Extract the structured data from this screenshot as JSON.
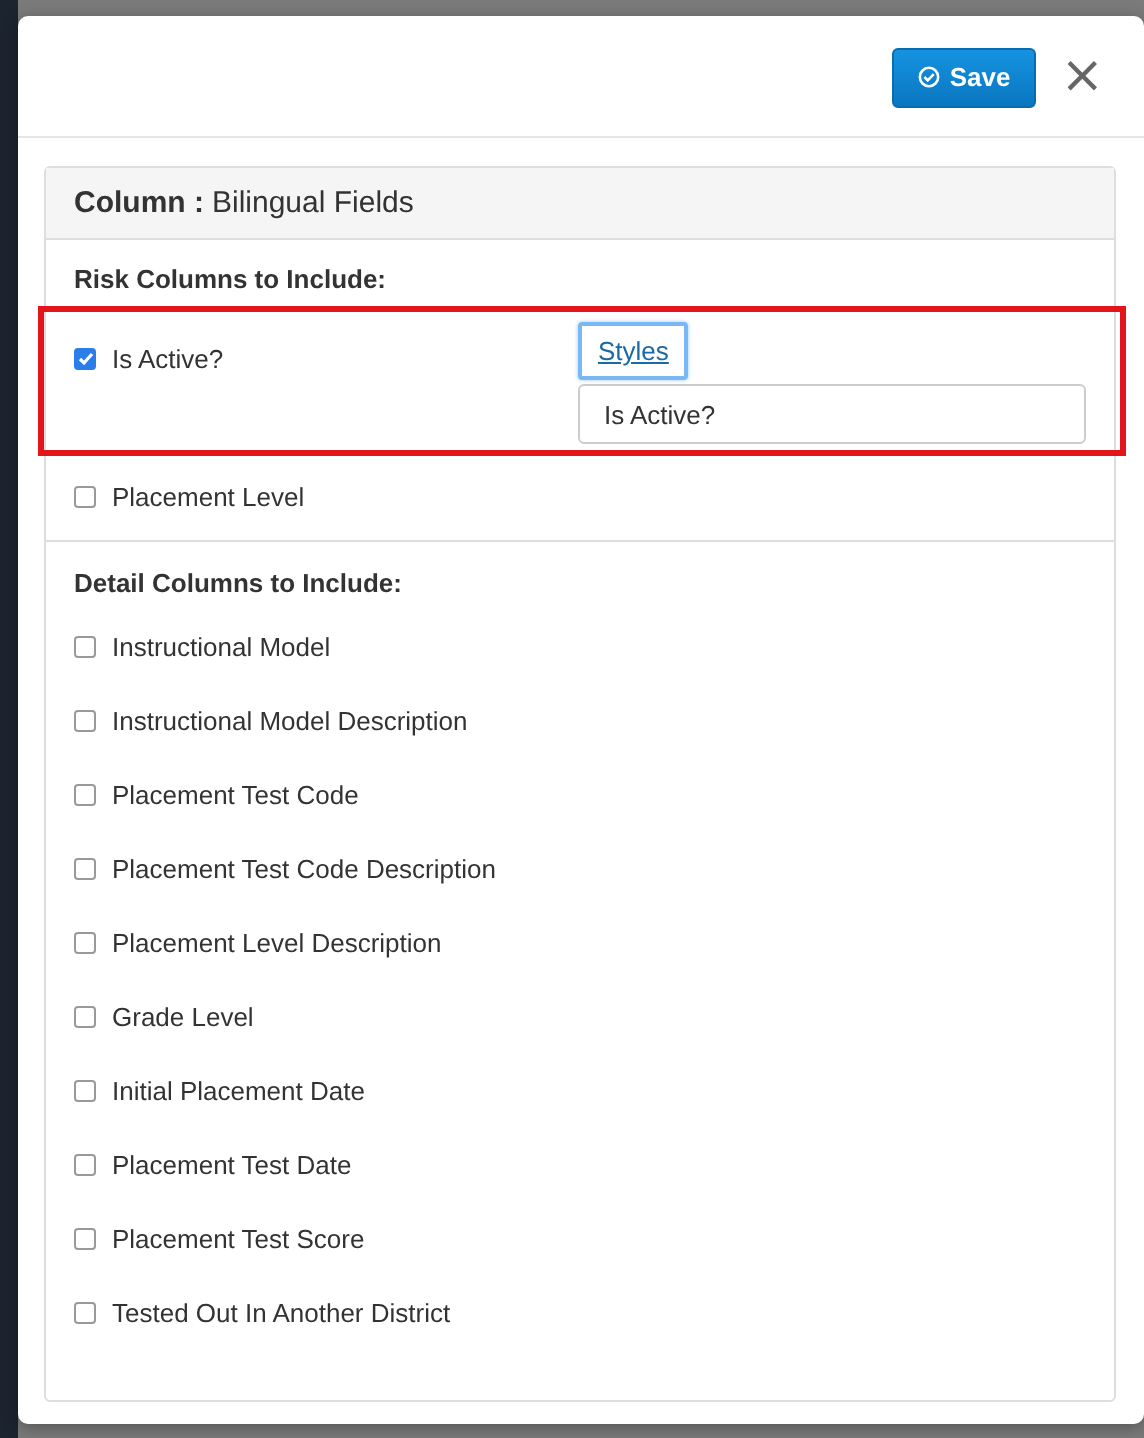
{
  "dialog": {
    "save_button": "Save",
    "close_button": "×"
  },
  "panel": {
    "title_label": "Column :",
    "title_value": "Bilingual Fields",
    "sections": [
      {
        "heading": "Risk Columns to Include:",
        "items": [
          {
            "label": "Is Active?",
            "checked": true,
            "highlighted": true,
            "styles_link": "Styles",
            "styles_focused": true,
            "style_value": "Is Active?"
          },
          {
            "label": "Placement Level",
            "checked": false,
            "highlighted": false
          }
        ]
      },
      {
        "heading": "Detail Columns to Include:",
        "items": [
          {
            "label": "Instructional Model",
            "checked": false,
            "highlighted": false
          },
          {
            "label": "Instructional Model Description",
            "checked": false,
            "highlighted": false
          },
          {
            "label": "Placement Test Code",
            "checked": false,
            "highlighted": false
          },
          {
            "label": "Placement Test Code Description",
            "checked": false,
            "highlighted": false
          },
          {
            "label": "Placement Level Description",
            "checked": false,
            "highlighted": false
          },
          {
            "label": "Grade Level",
            "checked": false,
            "highlighted": false
          },
          {
            "label": "Initial Placement Date",
            "checked": false,
            "highlighted": false
          },
          {
            "label": "Placement Test Date",
            "checked": false,
            "highlighted": false
          },
          {
            "label": "Placement Test Score",
            "checked": false,
            "highlighted": false
          },
          {
            "label": "Tested Out In Another District",
            "checked": false,
            "highlighted": false
          }
        ]
      }
    ]
  }
}
